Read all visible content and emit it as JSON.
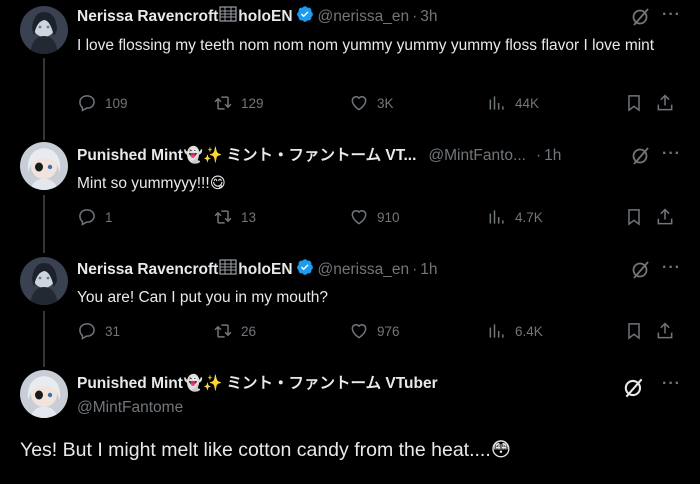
{
  "tweets": [
    {
      "name": "Nerissa Ravencroft",
      "name_suffix": "holoEN",
      "handle": "@nerissa_en",
      "dot": "·",
      "time": "3h",
      "text": "I love flossing my teeth nom nom nom yummy yummy yummy floss flavor I love mint",
      "replies": "109",
      "retweets": "129",
      "likes": "3K",
      "views": "44K"
    },
    {
      "name": "Punished Mint",
      "name_emoji": "👻✨",
      "name_jp": "ミント・ファントーム VT...",
      "handle": "@MintFanto...",
      "dot": "·",
      "time": "1h",
      "text": "Mint so yummyyy!!!😋",
      "replies": "1",
      "retweets": "13",
      "likes": "910",
      "views": "4.7K"
    },
    {
      "name": "Nerissa Ravencroft",
      "name_suffix": "holoEN",
      "handle": "@nerissa_en",
      "dot": "·",
      "time": "1h",
      "text": "You are! Can I put you in my mouth?",
      "replies": "31",
      "retweets": "26",
      "likes": "976",
      "views": "6.4K"
    },
    {
      "name": "Punished Mint",
      "name_emoji": "👻✨",
      "name_jp": "ミント・ファントーム VTuber",
      "handle": "@MintFantome",
      "text": "Yes! But I might melt like cotton candy from the heat....😳"
    }
  ],
  "more_glyph": "···",
  "icons": {
    "reply": "reply-icon",
    "retweet": "retweet-icon",
    "like": "heart-icon",
    "views": "views-icon",
    "bookmark": "bookmark-icon",
    "share": "share-icon",
    "verified": "verified-badge-icon",
    "grok": "grok-icon",
    "more": "more-icon"
  },
  "colors": {
    "background": "#000000",
    "text": "#e7e9ea",
    "muted": "#71767b",
    "verified": "#1d9bf0",
    "line": "#333639"
  }
}
